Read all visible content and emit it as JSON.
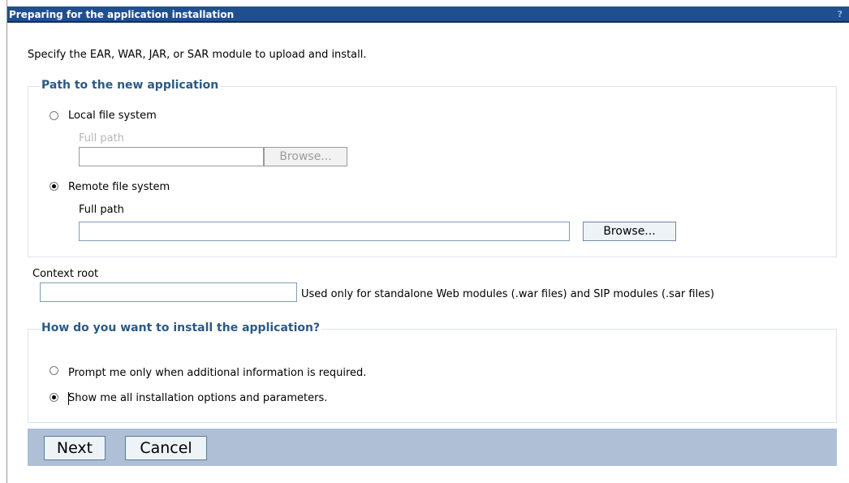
{
  "window": {
    "title": "Preparing for the application installation",
    "help_label": "?"
  },
  "intro_text": "Specify the EAR, WAR, JAR, or SAR module to upload and install.",
  "path_section": {
    "legend": "Path to the new application",
    "local": {
      "label": "Local file system",
      "selected": false,
      "full_path_label": "Full path",
      "full_path_value": "",
      "browse_label": "Browse...",
      "enabled": false
    },
    "remote": {
      "label": "Remote file system",
      "selected": true,
      "full_path_label": "Full path",
      "full_path_value": "",
      "browse_label": "Browse...",
      "enabled": true
    }
  },
  "context_root": {
    "label": "Context root",
    "value": "",
    "hint": "Used only for standalone Web modules (.war files) and SIP modules (.sar files)"
  },
  "install_section": {
    "legend": "How do you want to install the application?",
    "options": [
      {
        "label": "Prompt me only when additional information is required.",
        "selected": false
      },
      {
        "label": "Show me all installation options and parameters.",
        "selected": true
      }
    ]
  },
  "footer": {
    "next_label": "Next",
    "cancel_label": "Cancel"
  }
}
